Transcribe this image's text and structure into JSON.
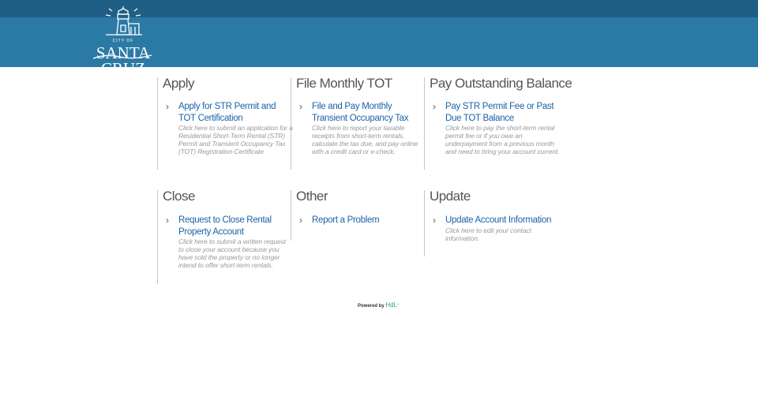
{
  "header": {
    "logo_small": "CITY OF",
    "logo_text": "SANTA CRUZ"
  },
  "sections": [
    {
      "title": "Apply",
      "link": "Apply for STR Permit and TOT Certification",
      "desc": "Click here to submit an application for a Residential Short-Term Rental (STR) Permit and Transient Occupancy Tax (TOT) Registration Certificate"
    },
    {
      "title": "File Monthly TOT",
      "link": "File and Pay Monthly Transient Occupancy Tax",
      "desc": "Click here to report your taxable receipts from short-term rentals, calculate the tax due, and pay online with a credit card or e-check."
    },
    {
      "title": "Pay Outstanding Balance",
      "link": "Pay STR Permit Fee or Past Due TOT Balance",
      "desc": "Click here to pay the short-term rental permit fee or if you owe an underpayment from a previous month and need to bring your account current."
    },
    {
      "title": "Close",
      "link": "Request to Close Rental Property Account",
      "desc": "Click here to submit a written request to close your account because you have sold the property or no longer intend to offer short-term rentals."
    },
    {
      "title": "Other",
      "link": "Report a Problem",
      "desc": ""
    },
    {
      "title": "Update",
      "link": "Update Account Information",
      "desc": "Click here to edit your contact information."
    }
  ],
  "footer": {
    "powered_by": "Powered by",
    "brand": "HdL"
  }
}
